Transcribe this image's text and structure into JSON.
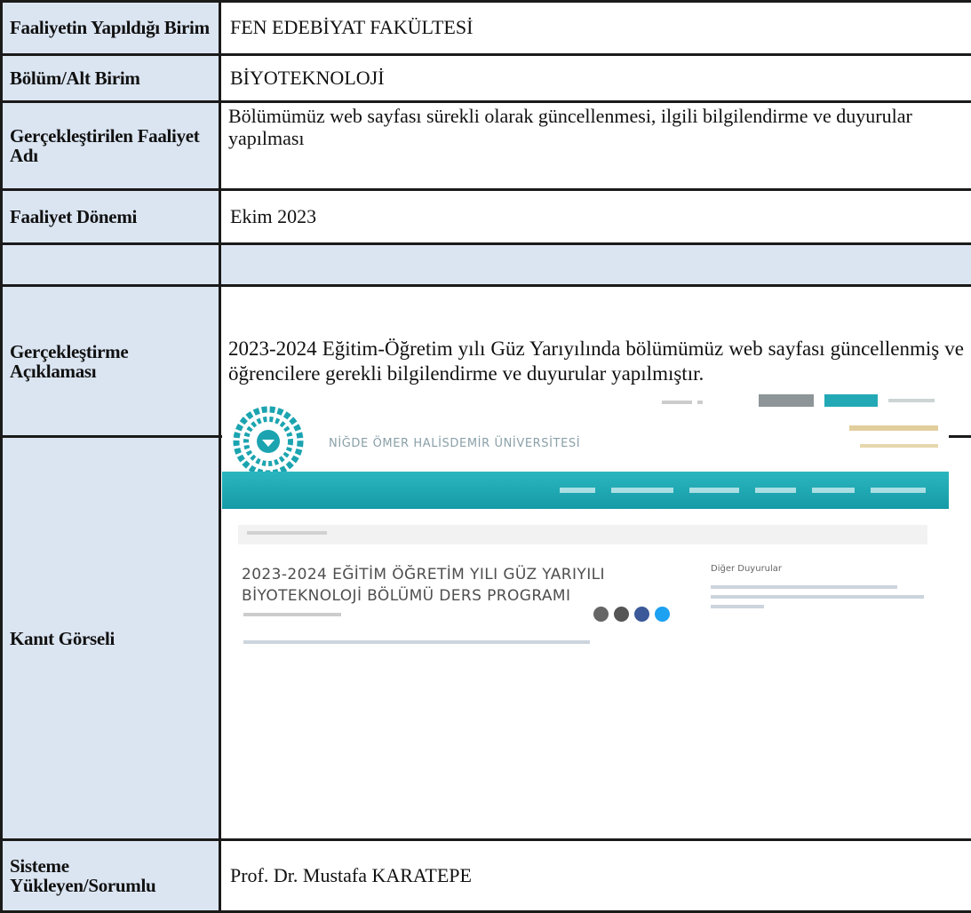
{
  "rows": [
    {
      "label": "Faaliyetin Yapıldığı Birim",
      "value": "FEN EDEBİYAT FAKÜLTESİ"
    },
    {
      "label": "Bölüm/Alt Birim",
      "value": "BİYOTEKNOLOJİ"
    },
    {
      "label": "Gerçekleştirilen Faaliyet Adı",
      "value": "Bölümümüz web sayfası sürekli olarak güncellenmesi, ilgili bilgilendirme ve duyurular yapılması"
    },
    {
      "label": "Faaliyet Dönemi",
      "value": "Ekim 2023"
    },
    {
      "label": "Gerçekleştirme Açıklaması",
      "value": "2023-2024 Eğitim-Öğretim yılı Güz Yarıyılında bölümümüz web sayfası güncellenmiş ve öğrencilere gerekli bilgilendirme ve duyurular yapılmıştır."
    },
    {
      "label": "Kanıt Görseli"
    },
    {
      "label": "Sisteme Yükleyen/Sorumlu",
      "value": "Prof. Dr. Mustafa KARATEPE"
    }
  ],
  "evidence": {
    "university": "NİĞDE ÖMER HALİSDEMİR ÜNİVERSİTESİ",
    "post_title": "2023-2024 EĞİTİM ÖĞRETİM YILI GÜZ YARIYILI BİYOTEKNOLOJİ BÖLÜMÜ DERS PROGRAMI",
    "sidebar_title": "Diğer Duyurular",
    "accent_color": "#1ba4b0",
    "label_bg": "#dbe5f2"
  }
}
